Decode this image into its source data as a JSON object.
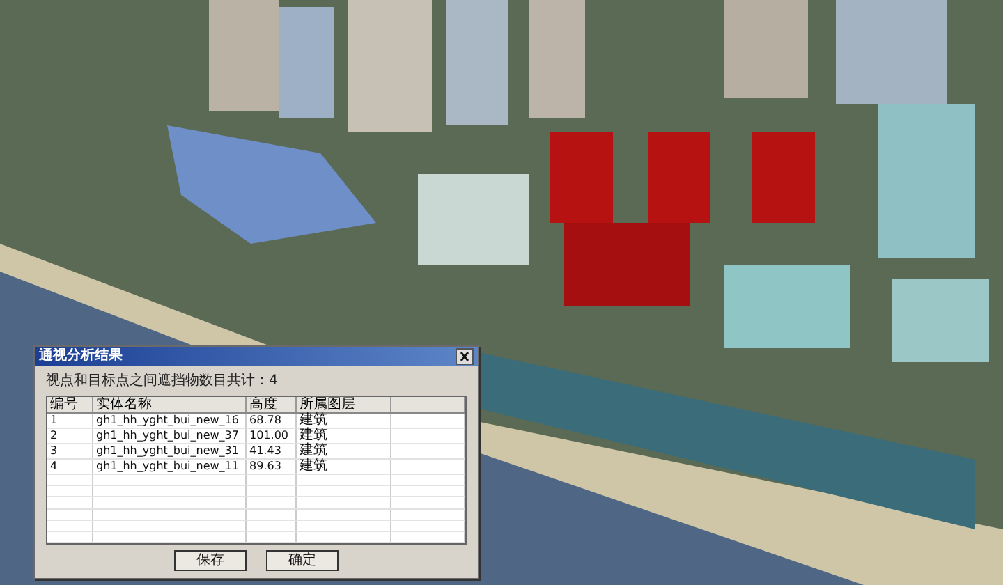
{
  "dialog": {
    "title": "通视分析结果",
    "summary": "视点和目标点之间遮挡物数目共计：4",
    "table": {
      "columns": [
        "编号",
        "实体名称",
        "高度",
        "所属图层"
      ],
      "rows": [
        [
          "1",
          "gh1_hh_yght_bui_new_16",
          "68.78",
          "建筑"
        ],
        [
          "2",
          "gh1_hh_yght_bui_new_37",
          "101.00",
          "建筑"
        ],
        [
          "3",
          "gh1_hh_yght_bui_new_31",
          "41.43",
          "建筑"
        ],
        [
          "4",
          "gh1_hh_yght_bui_new_11",
          "89.63",
          "建筑"
        ]
      ]
    },
    "buttons": [
      "保存",
      "确定"
    ]
  }
}
